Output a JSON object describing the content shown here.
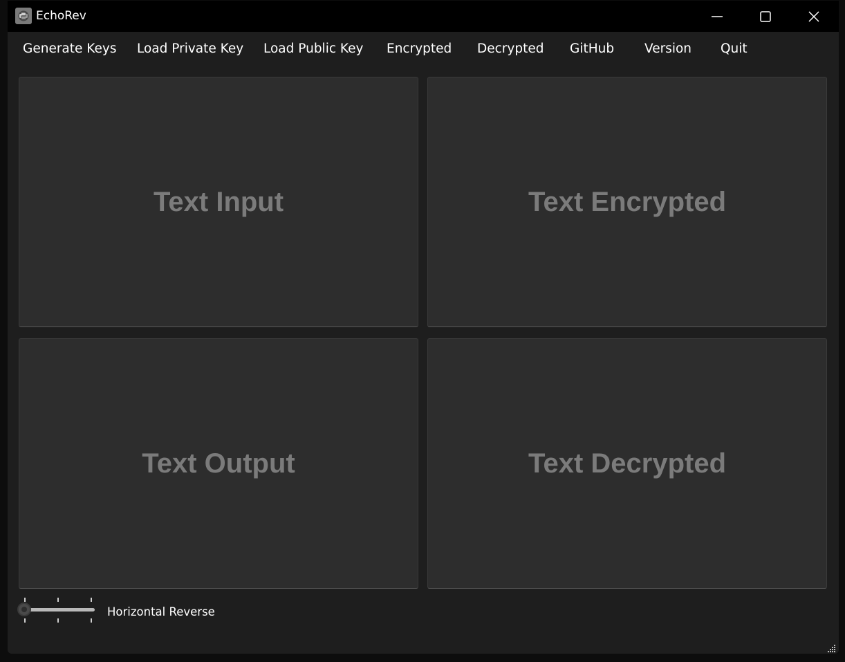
{
  "window": {
    "title": "EchoRev",
    "app_icon": "python-logo-icon",
    "controls": [
      "minimize-icon",
      "maximize-icon",
      "close-icon"
    ]
  },
  "menu": {
    "items": [
      {
        "label": "Generate Keys"
      },
      {
        "label": "Load Private Key"
      },
      {
        "label": "Load Public Key"
      },
      {
        "label": "Encrypted"
      },
      {
        "label": "Decrypted"
      },
      {
        "label": "GitHub"
      },
      {
        "label": "Version"
      },
      {
        "label": "Quit"
      }
    ]
  },
  "panels": {
    "input": {
      "placeholder": "Text Input"
    },
    "encrypted": {
      "placeholder": "Text Encrypted"
    },
    "output": {
      "placeholder": "Text Output"
    },
    "decrypted": {
      "placeholder": "Text Decrypted"
    }
  },
  "slider": {
    "label": "Horizontal Reverse",
    "value": 0,
    "min": 0,
    "max": 2
  },
  "colors": {
    "titlebar": "#000000",
    "window_bg": "#1e1e1e",
    "panel_bg": "#2d2d2d",
    "placeholder_text": "#7b7b7b",
    "text": "#ffffff"
  }
}
